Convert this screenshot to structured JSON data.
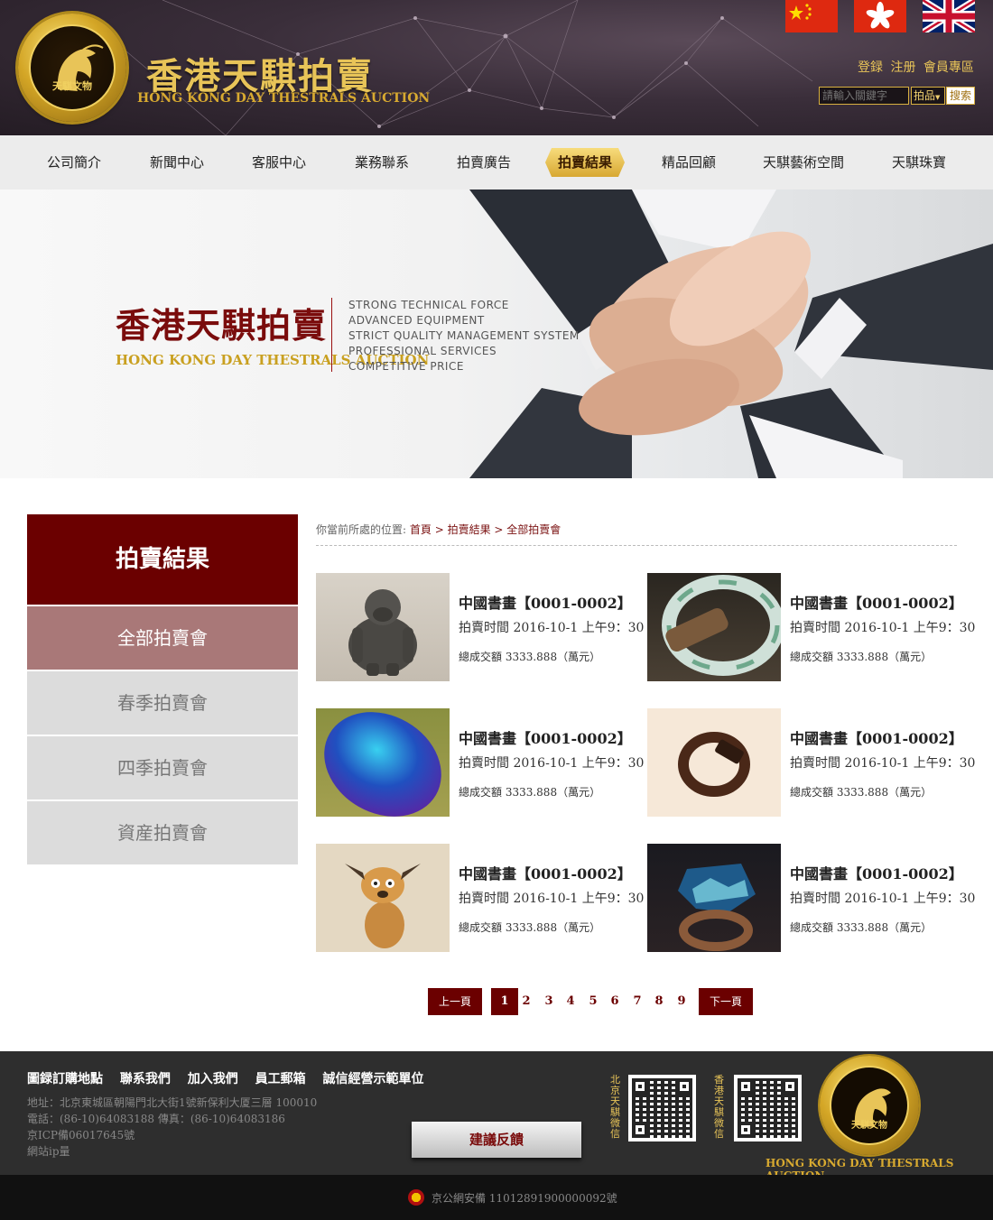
{
  "header": {
    "logo_seal_text": "天騏文物",
    "title": "香港天騏拍賣",
    "subtitle": "HONG KONG DAY THESTRALS AUCTION",
    "member_links": [
      "登録",
      "注册",
      "會員專區"
    ],
    "search": {
      "placeholder": "請輸入關鍵字",
      "category": "拍品",
      "button": "搜索"
    }
  },
  "nav": {
    "items": [
      "公司簡介",
      "新聞中心",
      "客服中心",
      "業務聯系",
      "拍賣廣告",
      "拍賣結果",
      "精品回顧",
      "天騏藝術空間",
      "天騏珠寶"
    ],
    "active_index": 5
  },
  "banner": {
    "title": "香港天騏拍賣",
    "subtitle": "HONG KONG DAY THESTRALS AUCTION",
    "lines": [
      "STRONG TECHNICAL FORCE",
      "ADVANCED EQUIPMENT",
      "STRICT QUALITY MANAGEMENT SYSTEM",
      "PROFESSIONAL SERVICES",
      "COMPETITIVE PRICE"
    ]
  },
  "sidebar": {
    "title": "拍賣結果",
    "items": [
      "全部拍賣會",
      "春季拍賣會",
      "四季拍賣會",
      "資産拍賣會"
    ],
    "active_index": 0
  },
  "breadcrumb": {
    "prefix": "你當前所處的位置:",
    "home": "首頁",
    "sep1": " > ",
    "section": "拍賣結果",
    "sep2": " > ",
    "current": "全部拍賣會"
  },
  "products": [
    {
      "title": "中國書畫【0001-0002】",
      "time": "拍賣时間 2016-10-1 上午9：30",
      "total": "總成交額 3333.888（萬元）",
      "image": "gorilla-figurine"
    },
    {
      "title": "中國書畫【0001-0002】",
      "time": "拍賣时間 2016-10-1 上午9：30",
      "total": "總成交額 3333.888（萬元）",
      "image": "jade-bangle"
    },
    {
      "title": "中國書畫【0001-0002】",
      "time": "拍賣时間 2016-10-1 上午9：30",
      "total": "總成交額 3333.888（萬元）",
      "image": "blue-gemstone"
    },
    {
      "title": "中國書畫【0001-0002】",
      "time": "拍賣时間 2016-10-1 上午9：30",
      "total": "總成交額 3333.888（萬元）",
      "image": "wooden-ring"
    },
    {
      "title": "中國書畫【0001-0002】",
      "time": "拍賣时間 2016-10-1 上午9：30",
      "total": "總成交額 3333.888（萬元）",
      "image": "cartoon-dog"
    },
    {
      "title": "中國書畫【0001-0002】",
      "time": "拍賣时間 2016-10-1 上午9：30",
      "total": "總成交額 3333.888（萬元）",
      "image": "resin-landscape-ring"
    }
  ],
  "pagination": {
    "prev": "上一頁",
    "next": "下一頁",
    "pages": [
      "1",
      "2",
      "3",
      "4",
      "5",
      "6",
      "7",
      "8",
      "9"
    ],
    "current": "1"
  },
  "footer": {
    "links": [
      "圖録訂購地點",
      "聯系我們",
      "加入我們",
      "員工郵箱",
      "誠信經營示範單位"
    ],
    "info": [
      "地址：北京東城區朝陽門北大街1號新保利大厦三層 100010",
      "電話：(86-10)64083188 傳真：(86-10)64083186",
      "京ICP備06017645號",
      "網站ip量"
    ],
    "feedback_button": "建議反饋",
    "qr_labels": [
      "北京天騏微信",
      "香港天騏微信"
    ],
    "logo_seal_text": "天騏文物",
    "logo_subtitle": "HONG KONG DAY THESTRALS AUCTION"
  },
  "bottom": {
    "record": "京公網安備 11012891900000092號"
  },
  "colors": {
    "brand_dark_red": "#6b0000",
    "gold": "#e8c458",
    "footer_bg": "#2e2e2e"
  }
}
